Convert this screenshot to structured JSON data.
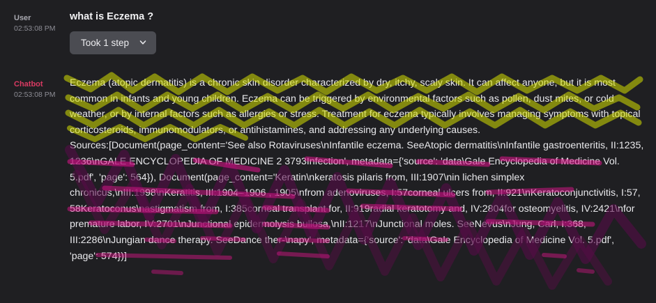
{
  "user_message": {
    "role": "User",
    "time": "02:53:08 PM",
    "text": "what is Eczema ?"
  },
  "steps_button": {
    "label": "Took 1 step",
    "icon": "chevron-down-icon"
  },
  "bot_message": {
    "role": "Chatbot",
    "time": "02:53:08 PM",
    "answer": "Eczema (atopic dermatitis) is a chronic skin disorder characterized by dry, itchy, scaly skin. It can affect anyone, but it is most common in infants and young children. Eczema can be triggered by environmental factors such as pollen, dust mites, or cold weather, or by internal factors such as allergies or stress. Treatment for eczema typically involves managing symptoms with topical corticosteroids, immunomodulators, or antihistamines, and addressing any underlying causes.",
    "sources": "Sources:[Document(page_content='See also Rotaviruses\\nInfantile eczema. SeeAtopic dermatitis\\nInfantile gastroenteritis, II:1235, 1236\\nGALE ENCYCLOPEDIA OF MEDICINE 2 3793Infection', metadata={'source': 'data\\Gale Encyclopedia of Medicine Vol. 5.pdf', 'page': 564}), Document(page_content='Keratin\\nkeratosis pilaris from, III:1907\\nin lichen simplex chronicus,\\nIII:1998\\nKeratitis, III:1904–1906 , 1905\\nfrom adenoviruses, I:57corneal ulcers from, II:921\\nKeratoconjunctivitis, I:57, 58Keratoconus\\nastigmatism from, I:385corneal transplant for, II:919radial keratotomy and, IV:2804for osteomyelitis, IV:2421\\nfor premature labor, IV:2701\\nJunctional epidermolysis bullosa,\\nII:1217\\nJunctional moles. SeeNevus\\nJung, Carl, I:368, III:2286\\nJungian dance therapy. SeeDance ther-\\napy', metadata={'source': 'data\\Gale Encyclopedia of Medicine Vol. 5.pdf', 'page': 574})]"
  },
  "colors": {
    "background": "#1f1f22",
    "bot_role": "#d93a62",
    "scribble_yellow": "#d6e000",
    "scribble_magenta": "#e0138c",
    "scribble_purple": "#5a0a4a"
  }
}
